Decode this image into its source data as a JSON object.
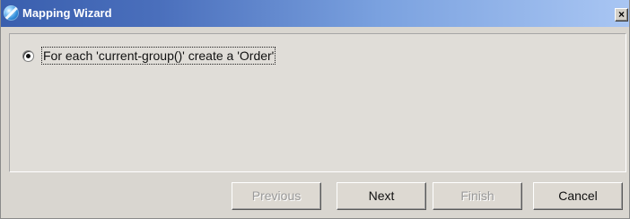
{
  "window": {
    "title": "Mapping Wizard",
    "close_label": "×"
  },
  "options": [
    {
      "label": "For each 'current-group()' create a 'Order'",
      "selected": true
    }
  ],
  "buttons": {
    "previous": "Previous",
    "next": "Next",
    "finish": "Finish",
    "cancel": "Cancel"
  },
  "icons": {
    "app": "app-orb-icon"
  },
  "colors": {
    "titlebar_start": "#3a5fae",
    "titlebar_end": "#a9c6f3",
    "window_bg": "#d9d6d0"
  }
}
